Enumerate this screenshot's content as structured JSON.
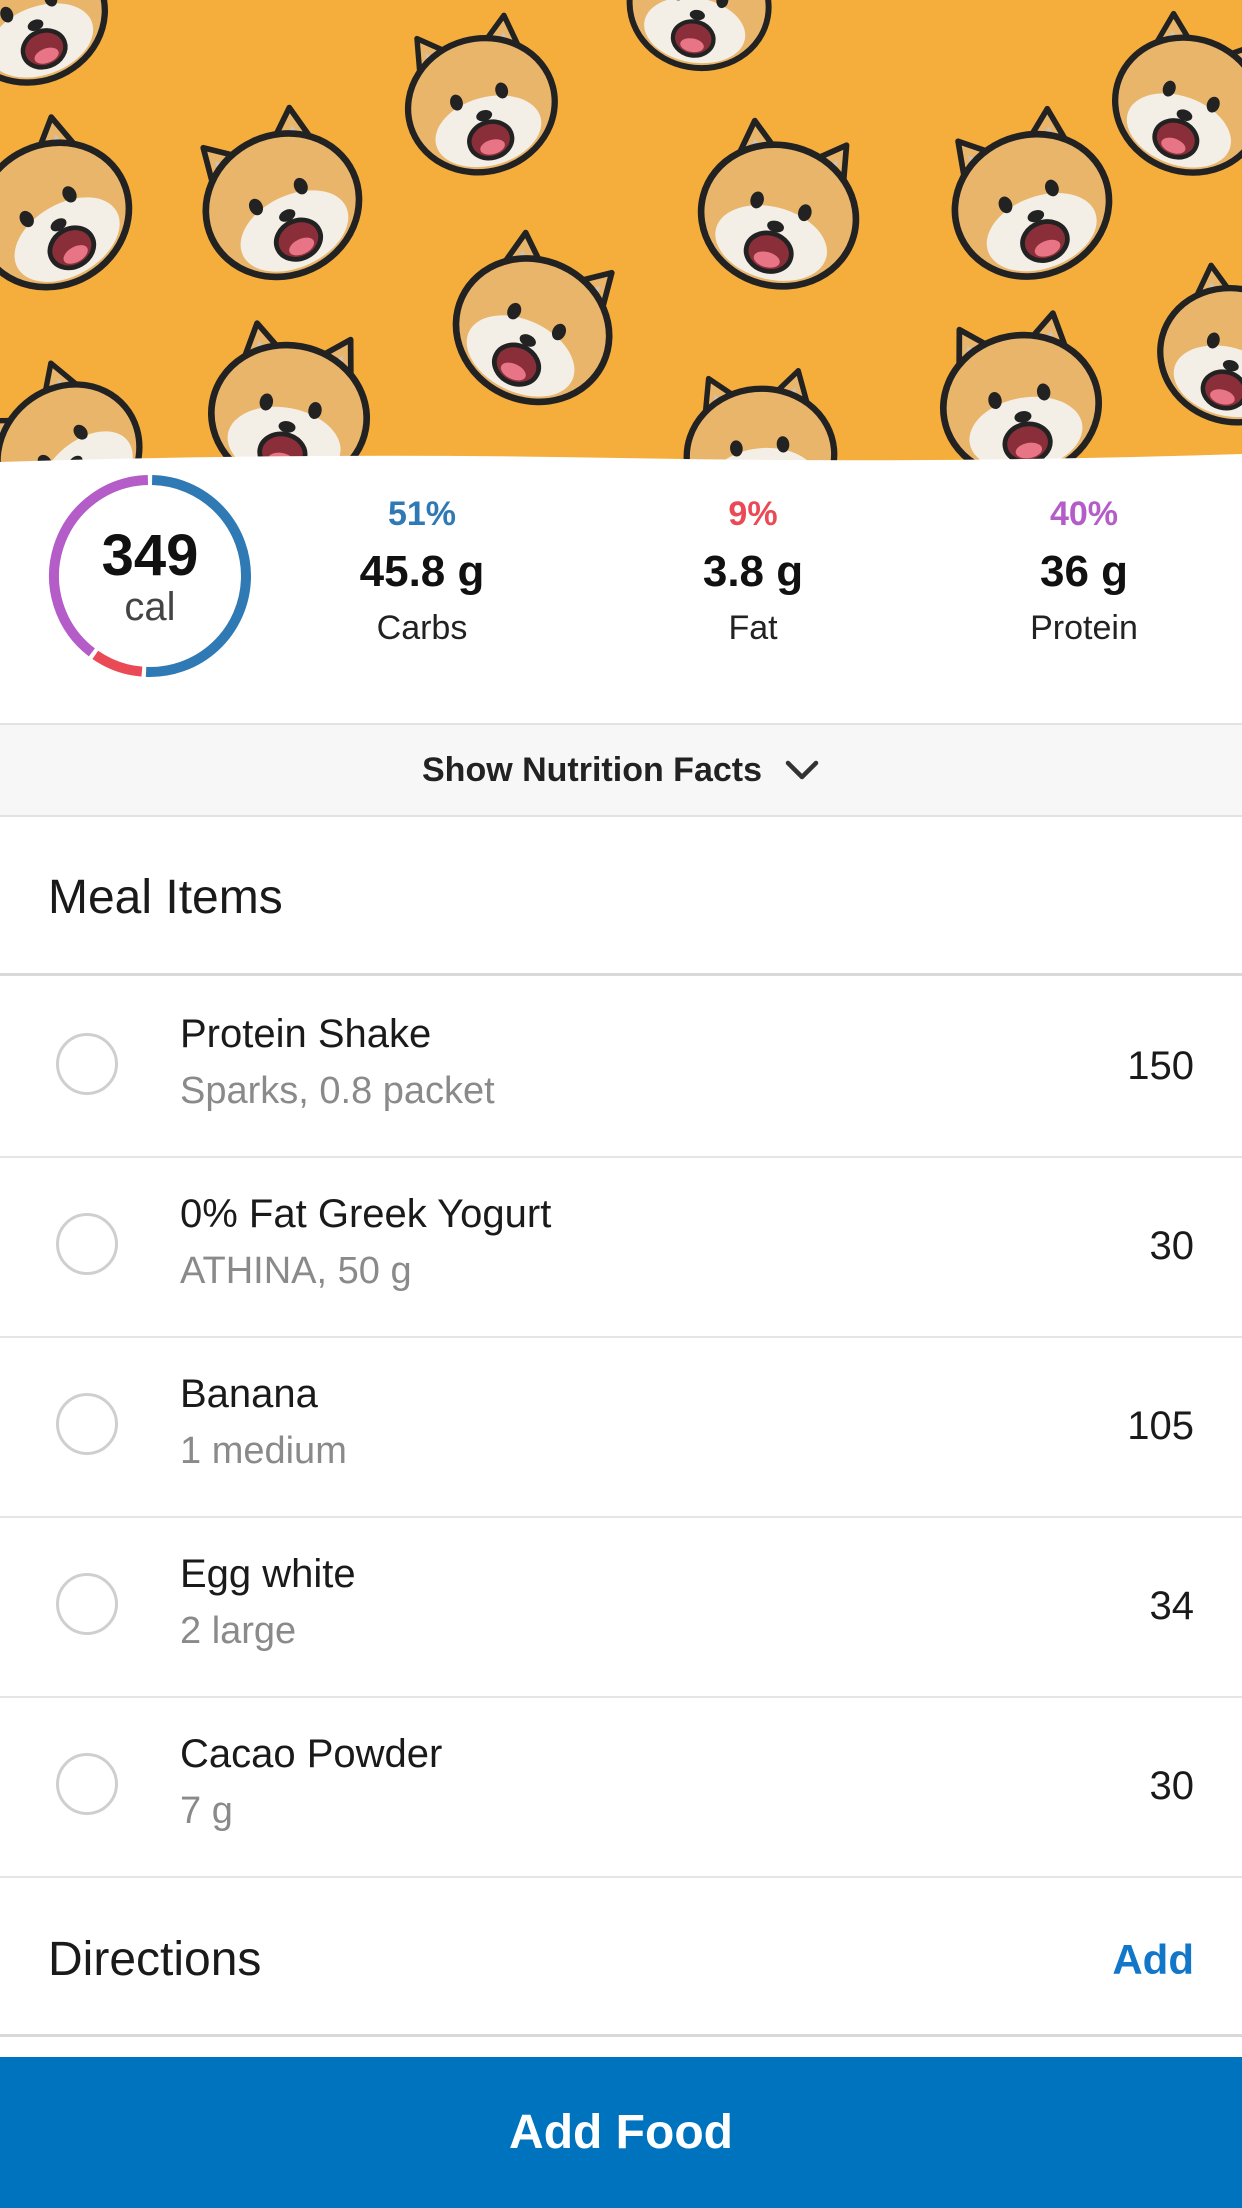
{
  "summary": {
    "calories": "349",
    "calories_unit": "cal",
    "macros": [
      {
        "percent": "51%",
        "amount": "45.8 g",
        "name": "Carbs",
        "color": "#2f7ab5",
        "share": 0.51
      },
      {
        "percent": "9%",
        "amount": "3.8 g",
        "name": "Fat",
        "color": "#ea4a56",
        "share": 0.09
      },
      {
        "percent": "40%",
        "amount": "36 g",
        "name": "Protein",
        "color": "#b45cc7",
        "share": 0.4
      }
    ]
  },
  "nutrition_toggle": {
    "label": "Show Nutrition Facts",
    "icon": "chevron-down-icon"
  },
  "meal_items": {
    "title": "Meal Items",
    "items": [
      {
        "name": "Protein Shake",
        "serving": "Sparks, 0.8 packet",
        "calories": "150"
      },
      {
        "name": "0% Fat Greek Yogurt",
        "serving": "ATHINA, 50 g",
        "calories": "30"
      },
      {
        "name": "Banana",
        "serving": "1 medium",
        "calories": "105"
      },
      {
        "name": "Egg white",
        "serving": "2 large",
        "calories": "34"
      },
      {
        "name": "Cacao Powder",
        "serving": "7 g",
        "calories": "30"
      }
    ]
  },
  "directions": {
    "title": "Directions",
    "add_label": "Add"
  },
  "footer": {
    "add_food_label": "Add Food"
  },
  "colors": {
    "hero_background": "#f5ad3c",
    "primary": "#0073bf",
    "link": "#1277c8"
  }
}
